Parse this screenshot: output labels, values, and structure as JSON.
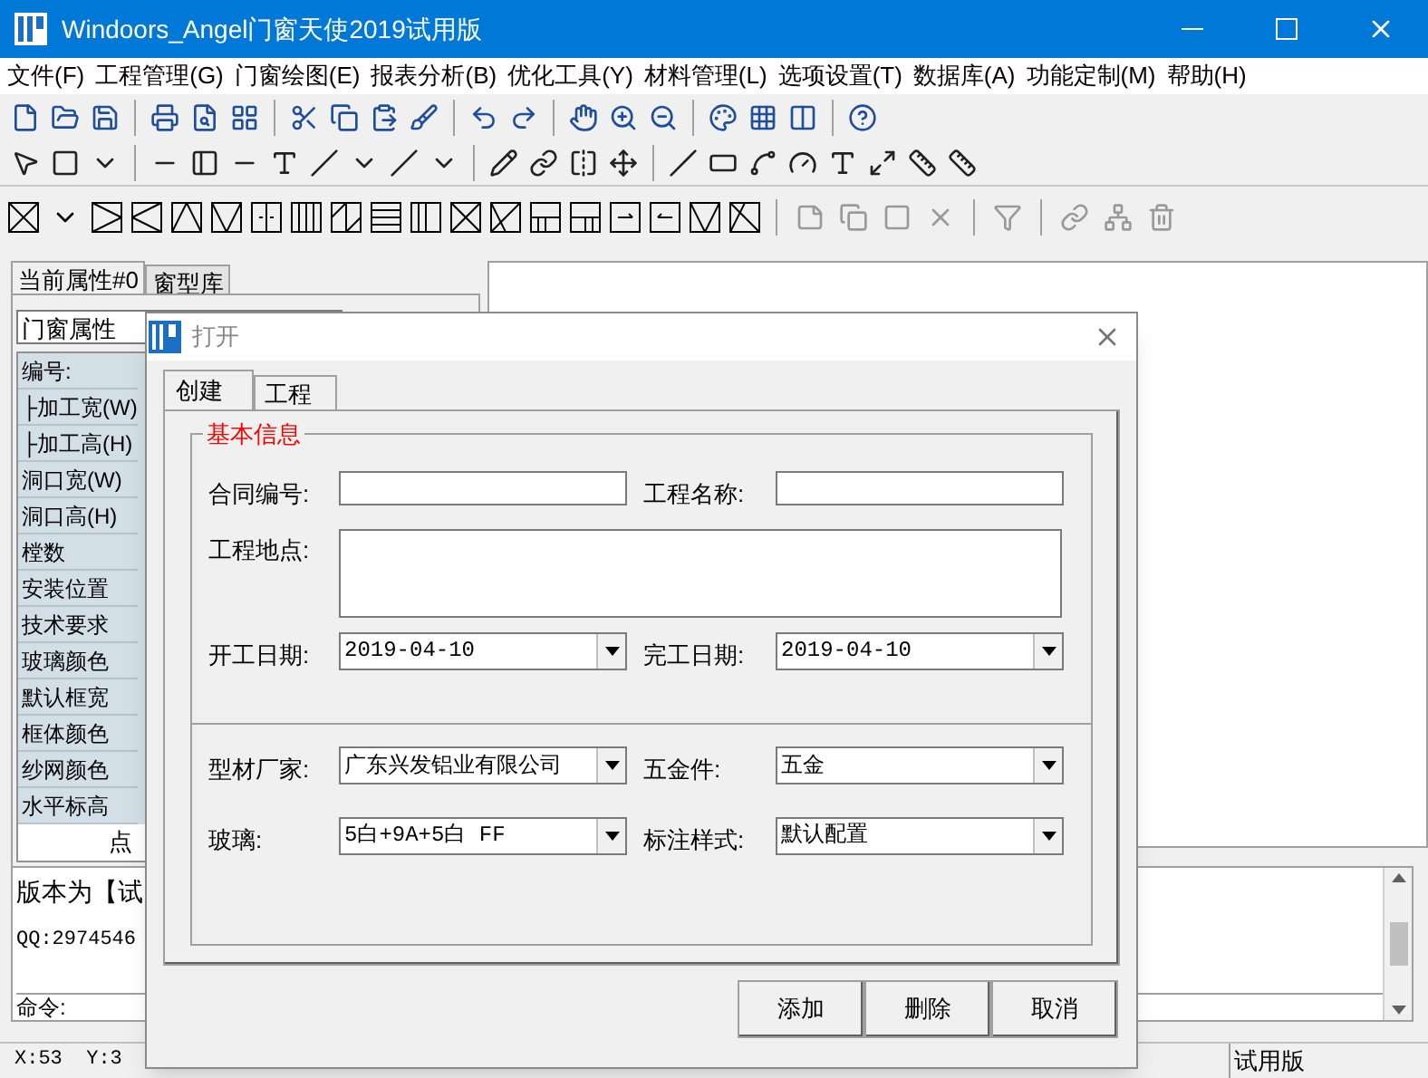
{
  "window": {
    "title": "Windoors_Angel门窗天使2019试用版"
  },
  "menu": [
    "文件(F)",
    "工程管理(G)",
    "门窗绘图(E)",
    "报表分析(B)",
    "优化工具(Y)",
    "材料管理(L)",
    "选项设置(T)",
    "数据库(A)",
    "功能定制(M)",
    "帮助(H)"
  ],
  "left_panel": {
    "tabs": [
      {
        "label": "当前属性#0",
        "selected": true
      },
      {
        "label": "窗型库",
        "selected": false
      }
    ],
    "dropdown": "门窗属性",
    "properties": [
      "编号:",
      "├加工宽(W)",
      "├加工高(H)",
      "洞口宽(W)",
      "洞口高(H)",
      "樘数",
      "安装位置",
      "技术要求",
      "玻璃颜色",
      "默认框宽",
      "框体颜色",
      "纱网颜色",
      "水平标高"
    ],
    "footer_text": "点"
  },
  "output": {
    "lines": [
      "版本为【试",
      "QQ:2974546"
    ],
    "command_label": "命令:"
  },
  "status_bar": [
    "X:53  Y:3",
    "试用版"
  ],
  "dialog": {
    "title": "打开",
    "tabs": [
      {
        "label": "创建",
        "selected": true
      },
      {
        "label": "工程",
        "selected": false
      }
    ],
    "group_title": "基本信息",
    "rows": [
      [
        {
          "label": "合同编号:",
          "kind": "text"
        },
        {
          "label": "工程名称:",
          "kind": "text"
        }
      ],
      [
        {
          "label": "工程地点:",
          "kind": "textarea"
        }
      ],
      [
        {
          "label": "开工日期:",
          "kind": "combo",
          "value": "2019-04-10"
        },
        {
          "label": "完工日期:",
          "kind": "combo",
          "value": "2019-04-10"
        }
      ],
      [
        {
          "label": "型材厂家:",
          "kind": "combo",
          "value": "广东兴发铝业有限公司"
        },
        {
          "label": "五金件:",
          "kind": "combo",
          "value": "五金"
        }
      ],
      [
        {
          "label": "玻璃:",
          "kind": "combo",
          "value": "5白+9A+5白 FF"
        },
        {
          "label": "标注样式:",
          "kind": "combo",
          "value": "默认配置"
        }
      ]
    ],
    "buttons": [
      "添加",
      "删除",
      "取消"
    ]
  }
}
